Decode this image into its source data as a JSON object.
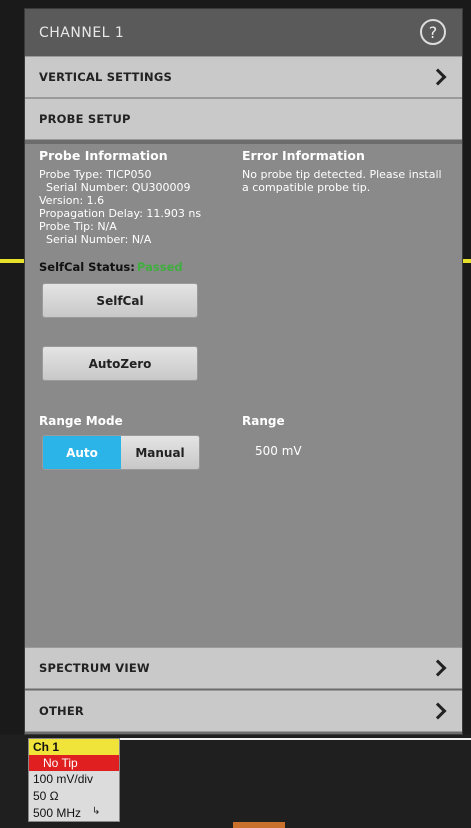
{
  "header": {
    "title": "CHANNEL 1",
    "help_icon": "?"
  },
  "sections": {
    "vertical_settings": "VERTICAL SETTINGS",
    "probe_setup": "PROBE SETUP",
    "spectrum_view": "SPECTRUM VIEW",
    "other": "OTHER"
  },
  "probe_info": {
    "heading": "Probe Information",
    "lines": [
      "Probe Type: TICP050",
      "  Serial Number: QU300009",
      "Version: 1.6",
      "Propagation Delay: 11.903 ns",
      "Probe Tip: N/A",
      "  Serial Number: N/A"
    ]
  },
  "error_info": {
    "heading": "Error Information",
    "message": "No probe tip detected. Please install a compatible probe tip."
  },
  "selfcal": {
    "label": "SelfCal Status:",
    "status": "Passed",
    "button": "SelfCal"
  },
  "autozero": {
    "button": "AutoZero"
  },
  "range_mode": {
    "label": "Range Mode",
    "options": [
      "Auto",
      "Manual"
    ],
    "selected": "Auto"
  },
  "range": {
    "label": "Range",
    "value": "500 mV"
  },
  "channel_badge": {
    "name": "Ch 1",
    "tip": "No Tip",
    "scale": "100 mV/div",
    "impedance": "50 Ω",
    "bandwidth": "500 MHz"
  },
  "colors": {
    "accent_blue": "#2ab4e8",
    "trace_yellow": "#e6e02a",
    "error_red": "#e02020"
  }
}
